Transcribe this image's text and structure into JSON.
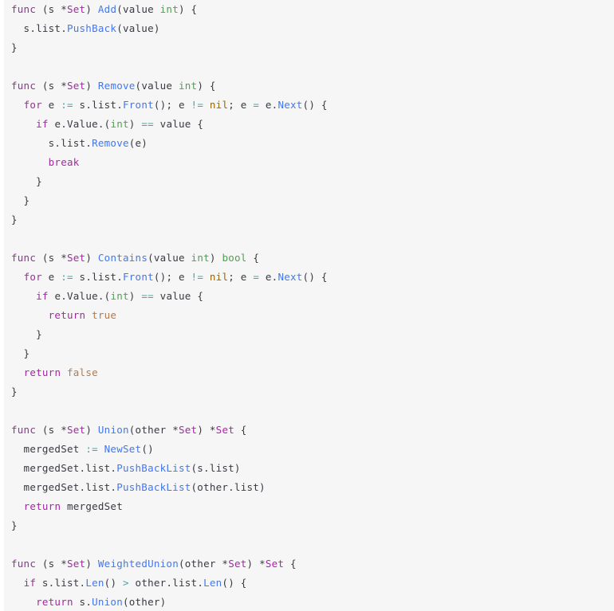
{
  "editor": {
    "language": "go",
    "background_color": "#f6f6f7",
    "gutter_color": "#ffffff",
    "default_text_color": "#383a42",
    "font_size_px": 12.5,
    "line_height_px": 24
  },
  "theme": {
    "keyword_color": "#a626a4",
    "function_color": "#4078f2",
    "builtin_type_color": "#50a14f",
    "nil_color": "#986801",
    "boolean_color": "#b5794a",
    "operator_color": "#4ca5a5",
    "plain_color": "#383a42"
  },
  "code": {
    "lines": [
      {
        "id": "l1",
        "tokens": [
          {
            "t": "func",
            "c": "kw"
          },
          {
            "t": " (s ",
            "c": "pn"
          },
          {
            "t": "*",
            "c": "pn"
          },
          {
            "t": "Set",
            "c": "type"
          },
          {
            "t": ") ",
            "c": "pn"
          },
          {
            "t": "Add",
            "c": "fn"
          },
          {
            "t": "(value ",
            "c": "pn"
          },
          {
            "t": "int",
            "c": "btin"
          },
          {
            "t": ") {",
            "c": "pn"
          }
        ]
      },
      {
        "id": "l2",
        "tokens": [
          {
            "t": "  s.list.",
            "c": "pn"
          },
          {
            "t": "PushBack",
            "c": "fn"
          },
          {
            "t": "(value)",
            "c": "pn"
          }
        ]
      },
      {
        "id": "l3",
        "tokens": [
          {
            "t": "}",
            "c": "pn"
          }
        ]
      },
      {
        "id": "l4",
        "tokens": []
      },
      {
        "id": "l5",
        "tokens": [
          {
            "t": "func",
            "c": "kw"
          },
          {
            "t": " (s ",
            "c": "pn"
          },
          {
            "t": "*",
            "c": "pn"
          },
          {
            "t": "Set",
            "c": "type"
          },
          {
            "t": ") ",
            "c": "pn"
          },
          {
            "t": "Remove",
            "c": "fn"
          },
          {
            "t": "(value ",
            "c": "pn"
          },
          {
            "t": "int",
            "c": "btin"
          },
          {
            "t": ") {",
            "c": "pn"
          }
        ]
      },
      {
        "id": "l6",
        "tokens": [
          {
            "t": "  ",
            "c": "pn"
          },
          {
            "t": "for",
            "c": "kw"
          },
          {
            "t": " e ",
            "c": "pn"
          },
          {
            "t": ":=",
            "c": "op"
          },
          {
            "t": " s.list.",
            "c": "pn"
          },
          {
            "t": "Front",
            "c": "fn"
          },
          {
            "t": "(); e ",
            "c": "pn"
          },
          {
            "t": "!=",
            "c": "op"
          },
          {
            "t": " ",
            "c": "pn"
          },
          {
            "t": "nil",
            "c": "nil"
          },
          {
            "t": "; e ",
            "c": "pn"
          },
          {
            "t": "=",
            "c": "op"
          },
          {
            "t": " e.",
            "c": "pn"
          },
          {
            "t": "Next",
            "c": "fn"
          },
          {
            "t": "() {",
            "c": "pn"
          }
        ]
      },
      {
        "id": "l7",
        "tokens": [
          {
            "t": "    ",
            "c": "pn"
          },
          {
            "t": "if",
            "c": "kw"
          },
          {
            "t": " e.Value.(",
            "c": "pn"
          },
          {
            "t": "int",
            "c": "btin"
          },
          {
            "t": ") ",
            "c": "pn"
          },
          {
            "t": "==",
            "c": "op"
          },
          {
            "t": " value {",
            "c": "pn"
          }
        ]
      },
      {
        "id": "l8",
        "tokens": [
          {
            "t": "      s.list.",
            "c": "pn"
          },
          {
            "t": "Remove",
            "c": "fn"
          },
          {
            "t": "(e)",
            "c": "pn"
          }
        ]
      },
      {
        "id": "l9",
        "tokens": [
          {
            "t": "      ",
            "c": "pn"
          },
          {
            "t": "break",
            "c": "kw"
          }
        ]
      },
      {
        "id": "l10",
        "tokens": [
          {
            "t": "    }",
            "c": "pn"
          }
        ]
      },
      {
        "id": "l11",
        "tokens": [
          {
            "t": "  }",
            "c": "pn"
          }
        ]
      },
      {
        "id": "l12",
        "tokens": [
          {
            "t": "}",
            "c": "pn"
          }
        ]
      },
      {
        "id": "l13",
        "tokens": []
      },
      {
        "id": "l14",
        "tokens": [
          {
            "t": "func",
            "c": "kw"
          },
          {
            "t": " (s ",
            "c": "pn"
          },
          {
            "t": "*",
            "c": "pn"
          },
          {
            "t": "Set",
            "c": "type"
          },
          {
            "t": ") ",
            "c": "pn"
          },
          {
            "t": "Contains",
            "c": "fn"
          },
          {
            "t": "(value ",
            "c": "pn"
          },
          {
            "t": "int",
            "c": "btin"
          },
          {
            "t": ") ",
            "c": "pn"
          },
          {
            "t": "bool",
            "c": "btin"
          },
          {
            "t": " {",
            "c": "pn"
          }
        ]
      },
      {
        "id": "l15",
        "tokens": [
          {
            "t": "  ",
            "c": "pn"
          },
          {
            "t": "for",
            "c": "kw"
          },
          {
            "t": " e ",
            "c": "pn"
          },
          {
            "t": ":=",
            "c": "op"
          },
          {
            "t": " s.list.",
            "c": "pn"
          },
          {
            "t": "Front",
            "c": "fn"
          },
          {
            "t": "(); e ",
            "c": "pn"
          },
          {
            "t": "!=",
            "c": "op"
          },
          {
            "t": " ",
            "c": "pn"
          },
          {
            "t": "nil",
            "c": "nil"
          },
          {
            "t": "; e ",
            "c": "pn"
          },
          {
            "t": "=",
            "c": "op"
          },
          {
            "t": " e.",
            "c": "pn"
          },
          {
            "t": "Next",
            "c": "fn"
          },
          {
            "t": "() {",
            "c": "pn"
          }
        ]
      },
      {
        "id": "l16",
        "tokens": [
          {
            "t": "    ",
            "c": "pn"
          },
          {
            "t": "if",
            "c": "kw"
          },
          {
            "t": " e.Value.(",
            "c": "pn"
          },
          {
            "t": "int",
            "c": "btin"
          },
          {
            "t": ") ",
            "c": "pn"
          },
          {
            "t": "==",
            "c": "op"
          },
          {
            "t": " value {",
            "c": "pn"
          }
        ]
      },
      {
        "id": "l17",
        "tokens": [
          {
            "t": "      ",
            "c": "pn"
          },
          {
            "t": "return",
            "c": "kw"
          },
          {
            "t": " ",
            "c": "pn"
          },
          {
            "t": "true",
            "c": "bool"
          }
        ]
      },
      {
        "id": "l18",
        "tokens": [
          {
            "t": "    }",
            "c": "pn"
          }
        ]
      },
      {
        "id": "l19",
        "tokens": [
          {
            "t": "  }",
            "c": "pn"
          }
        ]
      },
      {
        "id": "l20",
        "tokens": [
          {
            "t": "  ",
            "c": "pn"
          },
          {
            "t": "return",
            "c": "kw"
          },
          {
            "t": " ",
            "c": "pn"
          },
          {
            "t": "false",
            "c": "bool"
          }
        ]
      },
      {
        "id": "l21",
        "tokens": [
          {
            "t": "}",
            "c": "pn"
          }
        ]
      },
      {
        "id": "l22",
        "tokens": []
      },
      {
        "id": "l23",
        "tokens": [
          {
            "t": "func",
            "c": "kw"
          },
          {
            "t": " (s ",
            "c": "pn"
          },
          {
            "t": "*",
            "c": "pn"
          },
          {
            "t": "Set",
            "c": "type"
          },
          {
            "t": ") ",
            "c": "pn"
          },
          {
            "t": "Union",
            "c": "fn"
          },
          {
            "t": "(other ",
            "c": "pn"
          },
          {
            "t": "*",
            "c": "pn"
          },
          {
            "t": "Set",
            "c": "type"
          },
          {
            "t": ") ",
            "c": "pn"
          },
          {
            "t": "*",
            "c": "pn"
          },
          {
            "t": "Set",
            "c": "type"
          },
          {
            "t": " {",
            "c": "pn"
          }
        ]
      },
      {
        "id": "l24",
        "tokens": [
          {
            "t": "  mergedSet ",
            "c": "pn"
          },
          {
            "t": ":=",
            "c": "op"
          },
          {
            "t": " ",
            "c": "pn"
          },
          {
            "t": "NewSet",
            "c": "fn"
          },
          {
            "t": "()",
            "c": "pn"
          }
        ]
      },
      {
        "id": "l25",
        "tokens": [
          {
            "t": "  mergedSet.list.",
            "c": "pn"
          },
          {
            "t": "PushBackList",
            "c": "fn"
          },
          {
            "t": "(s.list)",
            "c": "pn"
          }
        ]
      },
      {
        "id": "l26",
        "tokens": [
          {
            "t": "  mergedSet.list.",
            "c": "pn"
          },
          {
            "t": "PushBackList",
            "c": "fn"
          },
          {
            "t": "(other.list)",
            "c": "pn"
          }
        ]
      },
      {
        "id": "l27",
        "tokens": [
          {
            "t": "  ",
            "c": "pn"
          },
          {
            "t": "return",
            "c": "kw"
          },
          {
            "t": " mergedSet",
            "c": "pn"
          }
        ]
      },
      {
        "id": "l28",
        "tokens": [
          {
            "t": "}",
            "c": "pn"
          }
        ]
      },
      {
        "id": "l29",
        "tokens": []
      },
      {
        "id": "l30",
        "tokens": [
          {
            "t": "func",
            "c": "kw"
          },
          {
            "t": " (s ",
            "c": "pn"
          },
          {
            "t": "*",
            "c": "pn"
          },
          {
            "t": "Set",
            "c": "type"
          },
          {
            "t": ") ",
            "c": "pn"
          },
          {
            "t": "WeightedUnion",
            "c": "fn"
          },
          {
            "t": "(other ",
            "c": "pn"
          },
          {
            "t": "*",
            "c": "pn"
          },
          {
            "t": "Set",
            "c": "type"
          },
          {
            "t": ") ",
            "c": "pn"
          },
          {
            "t": "*",
            "c": "pn"
          },
          {
            "t": "Set",
            "c": "type"
          },
          {
            "t": " {",
            "c": "pn"
          }
        ]
      },
      {
        "id": "l31",
        "tokens": [
          {
            "t": "  ",
            "c": "pn"
          },
          {
            "t": "if",
            "c": "kw"
          },
          {
            "t": " s.list.",
            "c": "pn"
          },
          {
            "t": "Len",
            "c": "fn"
          },
          {
            "t": "() ",
            "c": "pn"
          },
          {
            "t": ">",
            "c": "op"
          },
          {
            "t": " other.list.",
            "c": "pn"
          },
          {
            "t": "Len",
            "c": "fn"
          },
          {
            "t": "() {",
            "c": "pn"
          }
        ]
      },
      {
        "id": "l32",
        "tokens": [
          {
            "t": "    ",
            "c": "pn"
          },
          {
            "t": "return",
            "c": "kw"
          },
          {
            "t": " s.",
            "c": "pn"
          },
          {
            "t": "Union",
            "c": "fn"
          },
          {
            "t": "(other)",
            "c": "pn"
          }
        ]
      }
    ]
  }
}
